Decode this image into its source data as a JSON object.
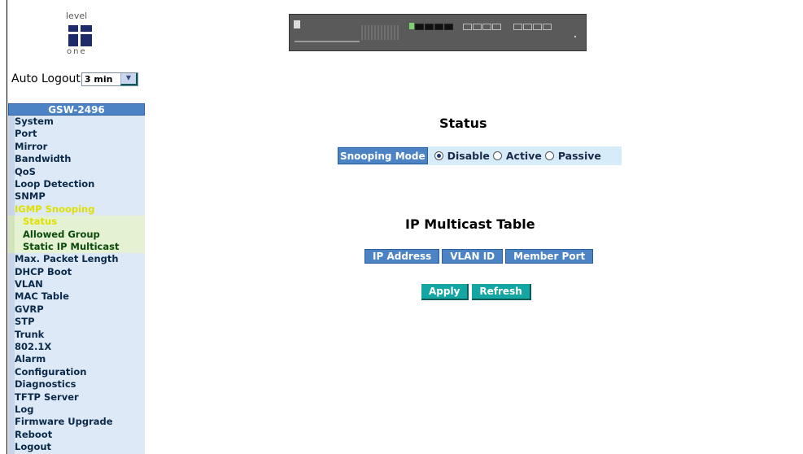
{
  "brand": {
    "logo_top": "level",
    "logo_bottom": "one"
  },
  "auto_logout": {
    "label": "Auto Logout",
    "selected": "3 min"
  },
  "menu": {
    "title": "GSW-2496",
    "items": [
      {
        "label": "System"
      },
      {
        "label": "Port"
      },
      {
        "label": "Mirror"
      },
      {
        "label": "Bandwidth"
      },
      {
        "label": "QoS"
      },
      {
        "label": "Loop Detection"
      },
      {
        "label": "SNMP"
      },
      {
        "label": "IGMP Snooping"
      },
      {
        "label": "Status"
      },
      {
        "label": "Allowed Group"
      },
      {
        "label": "Static IP Multicast"
      },
      {
        "label": "Max. Packet Length"
      },
      {
        "label": "DHCP Boot"
      },
      {
        "label": "VLAN"
      },
      {
        "label": "MAC Table"
      },
      {
        "label": "GVRP"
      },
      {
        "label": "STP"
      },
      {
        "label": "Trunk"
      },
      {
        "label": "802.1X"
      },
      {
        "label": "Alarm"
      },
      {
        "label": "Configuration"
      },
      {
        "label": "Diagnostics"
      },
      {
        "label": "TFTP Server"
      },
      {
        "label": "Log"
      },
      {
        "label": "Firmware Upgrade"
      },
      {
        "label": "Reboot"
      },
      {
        "label": "Logout"
      }
    ]
  },
  "status": {
    "heading": "Status",
    "snooping_label": "Snooping Mode",
    "options": [
      "Disable",
      "Active",
      "Passive"
    ],
    "selected": "Disable"
  },
  "ip_multicast": {
    "heading": "IP Multicast Table",
    "columns": [
      "IP Address",
      "VLAN ID",
      "Member Port"
    ]
  },
  "actions": {
    "apply": "Apply",
    "refresh": "Refresh"
  },
  "colors": {
    "menu_header": "#4c83c4",
    "menu_bg": "#dde9f6",
    "submenu_bg": "#e4f1d3",
    "active_text": "#e0e000",
    "button_bg": "#13a6a3"
  }
}
